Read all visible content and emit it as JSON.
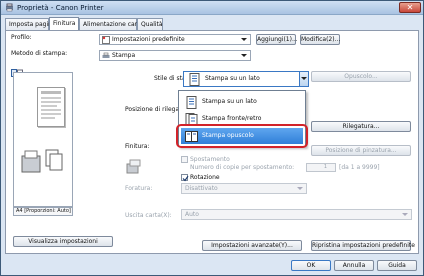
{
  "window": {
    "title": "Proprietà - Canon Printer",
    "close_label": "✕"
  },
  "tabs": [
    "Imposta pagina",
    "Finitura",
    "Alimentazione carta",
    "Qualità"
  ],
  "profile": {
    "label": "Profilo:",
    "value": "Impostazioni predefinite",
    "add_label": "Aggiungi(1)...",
    "edit_label": "Modifica(2)..."
  },
  "output_method": {
    "label": "Metodo di stampa:",
    "value": "Stampa"
  },
  "print_style": {
    "label": "Stile di stampa:",
    "value": "Stampa su un lato",
    "options": [
      "Stampa su un lato",
      "Stampa fronte/retro",
      "Stampa opuscolo"
    ],
    "selected_index": 2,
    "booklet_btn": "Opuscolo..."
  },
  "binding": {
    "label": "Posizione di rilegatura:",
    "btn": "Rilegatura..."
  },
  "finishing": {
    "label": "Finitura:",
    "position_btn": "Posizione di pinzatura...",
    "offset_label": "Spostamento",
    "copies_label": "Numero di copie per spostamento:",
    "copies_value": "1",
    "copies_range": "[da 1 a 9999]",
    "rotation_label": "Rotazione",
    "rotation_checked": true,
    "fold_label": "Foratura:",
    "fold_value": "Disattivato"
  },
  "output_tray": {
    "label": "Uscita carta(X):",
    "value": "Auto"
  },
  "preview_caption": "A4 [Proporzioni: Auto]",
  "view_settings_btn": "Visualizza impostazioni",
  "advanced_btn": "Impostazioni avanzate(Y)...",
  "restore_btn": "Ripristina impostazioni predefinite",
  "footer": {
    "ok": "OK",
    "cancel": "Annulla",
    "help": "Guida"
  },
  "colors": {
    "accent": "#2f7fd8",
    "highlight_border": "#d2232a"
  }
}
